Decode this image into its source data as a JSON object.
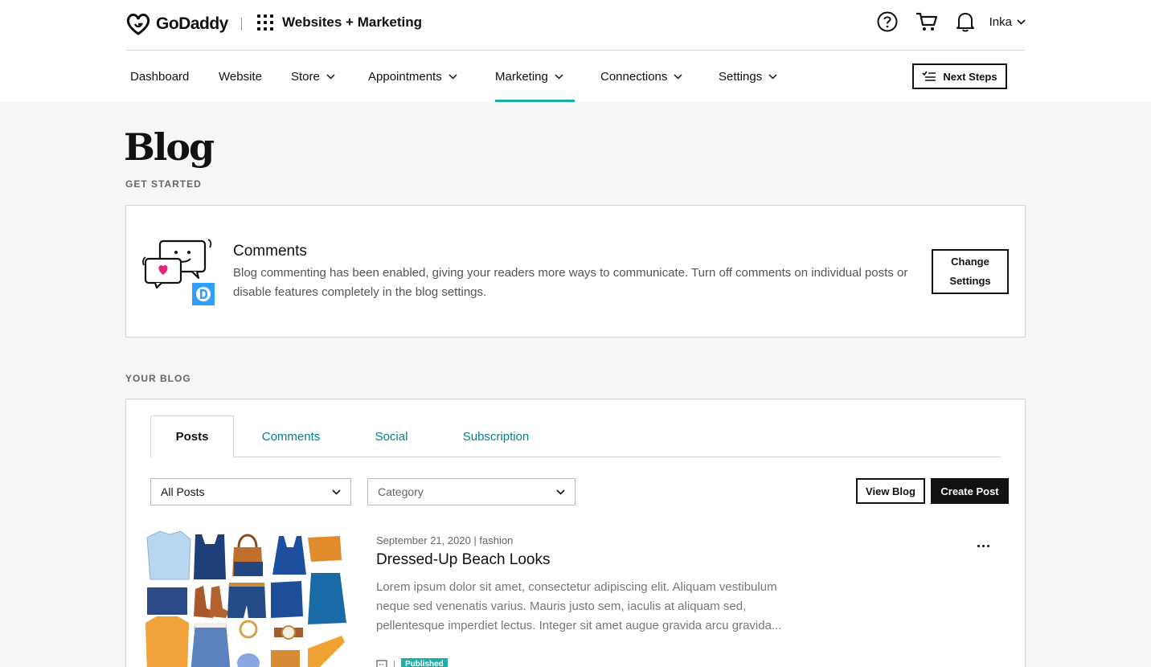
{
  "header": {
    "logo_text": "GoDaddy",
    "product_title": "Websites + Marketing",
    "user_name": "Inka"
  },
  "nav": {
    "items": [
      {
        "label": "Dashboard"
      },
      {
        "label": "Website"
      },
      {
        "label": "Store"
      },
      {
        "label": "Appointments"
      },
      {
        "label": "Marketing"
      },
      {
        "label": "Connections"
      },
      {
        "label": "Settings"
      }
    ],
    "active": "Marketing",
    "next_steps_label": "Next Steps"
  },
  "page": {
    "title": "Blog",
    "subtitle": "GET STARTED"
  },
  "comments_card": {
    "heading": "Comments",
    "body": "Blog commenting has been enabled, giving your readers more ways to communicate. Turn off comments on individual posts or disable features completely in the blog settings.",
    "button_label_line1": "Change",
    "button_label_line2": "Settings"
  },
  "your_blog": {
    "section_label": "YOUR BLOG",
    "tabs": [
      {
        "label": "Posts"
      },
      {
        "label": "Comments"
      },
      {
        "label": "Social"
      },
      {
        "label": "Subscription"
      }
    ],
    "active_tab": "Posts",
    "filter_posts": {
      "value": "All Posts"
    },
    "filter_category": {
      "placeholder": "Category"
    },
    "view_blog_label": "View Blog",
    "create_post_label": "Create Post",
    "posts": [
      {
        "meta": "September 21, 2020 | fashion",
        "title": "Dressed-Up Beach Looks",
        "excerpt": "Lorem ipsum dolor sit amet, consectetur adipiscing elit. Aliquam vestibulum neque sed venenatis varius. Mauris justo sem, iaculis at aliquam sed, pellentesque imperdiet lectus. Integer sit amet augue gravida arcu gravida...",
        "status": "Published"
      }
    ]
  },
  "colors": {
    "accent": "#1bb1a6",
    "tab_link": "#00838c",
    "disqus_blue": "#2e9fff",
    "heart_pink": "#e0267c"
  }
}
